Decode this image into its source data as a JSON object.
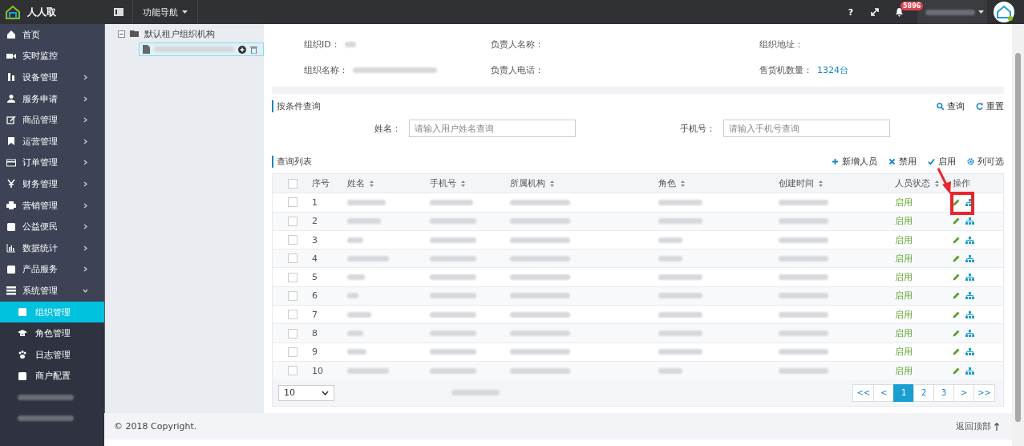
{
  "header": {
    "brand": "人人取",
    "nav_menu": "功能导航",
    "help": "?",
    "notification_count": "5896"
  },
  "sidebar": {
    "items": [
      {
        "label": "首页",
        "has_children": false
      },
      {
        "label": "实时监控",
        "has_children": false
      },
      {
        "label": "设备管理",
        "has_children": true,
        "expanded": false
      },
      {
        "label": "服务申请",
        "has_children": true,
        "expanded": false
      },
      {
        "label": "商品管理",
        "has_children": true,
        "expanded": false
      },
      {
        "label": "运营管理",
        "has_children": true,
        "expanded": false
      },
      {
        "label": "订单管理",
        "has_children": true,
        "expanded": false
      },
      {
        "label": "财务管理",
        "has_children": true,
        "expanded": false
      },
      {
        "label": "营销管理",
        "has_children": true,
        "expanded": false
      },
      {
        "label": "公益便民",
        "has_children": true,
        "expanded": false
      },
      {
        "label": "数据统计",
        "has_children": true,
        "expanded": false
      },
      {
        "label": "产品服务",
        "has_children": true,
        "expanded": false
      },
      {
        "label": "系统管理",
        "has_children": true,
        "expanded": true,
        "children": [
          {
            "label": "组织管理",
            "selected": true
          },
          {
            "label": "角色管理",
            "selected": false
          },
          {
            "label": "日志管理",
            "selected": false
          },
          {
            "label": "商户配置",
            "selected": false
          }
        ]
      }
    ]
  },
  "tree": {
    "root": {
      "label": "默认租户组织机构",
      "expanded": true,
      "children": [
        {
          "selected": true
        }
      ]
    }
  },
  "org_info": {
    "fields": [
      {
        "label": "组织ID："
      },
      {
        "label": "负责人名称："
      },
      {
        "label": "组织地址："
      },
      {
        "label": "组织名称："
      },
      {
        "label": "负责人电话："
      },
      {
        "label": "售货机数量：",
        "value": "1324台"
      }
    ]
  },
  "search": {
    "title": "按条件查询",
    "actions": [
      "查询",
      "重置"
    ],
    "fields": [
      {
        "label": "姓名：",
        "placeholder": "请输入用户姓名查询"
      },
      {
        "label": "手机号：",
        "placeholder": "请输入手机号查询"
      }
    ]
  },
  "list": {
    "title": "查询列表",
    "select_all_checked": false,
    "actions": [
      "新增人员",
      "禁用",
      "启用",
      "列可选"
    ],
    "columns": [
      {
        "label": "序号",
        "sortable": false
      },
      {
        "label": "姓名",
        "sortable": true
      },
      {
        "label": "手机号",
        "sortable": true
      },
      {
        "label": "所属机构",
        "sortable": true
      },
      {
        "label": "角色",
        "sortable": true
      },
      {
        "label": "创建时间",
        "sortable": true
      },
      {
        "label": "人员状态",
        "sortable": true
      },
      {
        "label": "操作",
        "sortable": false
      }
    ],
    "rows": [
      {
        "index": "1",
        "status": "启用",
        "checked": false
      },
      {
        "index": "2",
        "status": "启用",
        "checked": false
      },
      {
        "index": "3",
        "status": "启用",
        "checked": false
      },
      {
        "index": "4",
        "status": "启用",
        "checked": false
      },
      {
        "index": "5",
        "status": "启用",
        "checked": false
      },
      {
        "index": "6",
        "status": "启用",
        "checked": false
      },
      {
        "index": "7",
        "status": "启用",
        "checked": false
      },
      {
        "index": "8",
        "status": "启用",
        "checked": false
      },
      {
        "index": "9",
        "status": "启用",
        "checked": false
      },
      {
        "index": "10",
        "status": "启用",
        "checked": false
      }
    ],
    "page_size": "10",
    "pages": [
      {
        "label": "<<",
        "selected": false
      },
      {
        "label": "<",
        "selected": false
      },
      {
        "label": "1",
        "selected": true
      },
      {
        "label": "2",
        "selected": false
      },
      {
        "label": "3",
        "selected": false
      },
      {
        "label": ">",
        "selected": false
      },
      {
        "label": ">>",
        "selected": false
      }
    ]
  },
  "footer": {
    "copyright": "© 2018 Copyright.",
    "back_to_top": "返回顶部"
  }
}
